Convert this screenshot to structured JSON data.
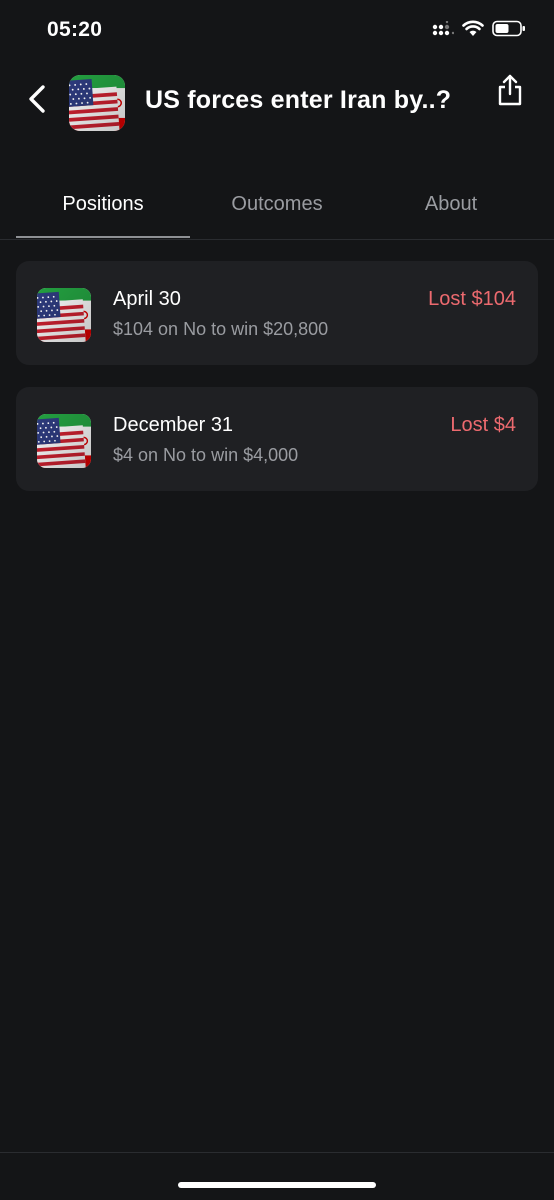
{
  "status_bar": {
    "time": "05:20",
    "icons": [
      "cellular-signal-icon",
      "wifi-icon",
      "battery-icon"
    ]
  },
  "header": {
    "title": "US forces enter Iran by..?",
    "back_icon": "chevron-left-icon",
    "share_icon": "share-icon",
    "thumbnail": "us-iran-flags"
  },
  "tabs": [
    {
      "label": "Positions",
      "active": true
    },
    {
      "label": "Outcomes",
      "active": false
    },
    {
      "label": "About",
      "active": false
    }
  ],
  "positions": [
    {
      "title": "April 30",
      "detail": "$104 on No to win $20,800",
      "result": "Lost $104"
    },
    {
      "title": "December 31",
      "detail": "$4 on No to win $4,000",
      "result": "Lost $4"
    }
  ],
  "colors": {
    "background": "#141517",
    "card": "#1f2023",
    "loss": "#ec6a6f",
    "muted_text": "#9a9ca1"
  }
}
